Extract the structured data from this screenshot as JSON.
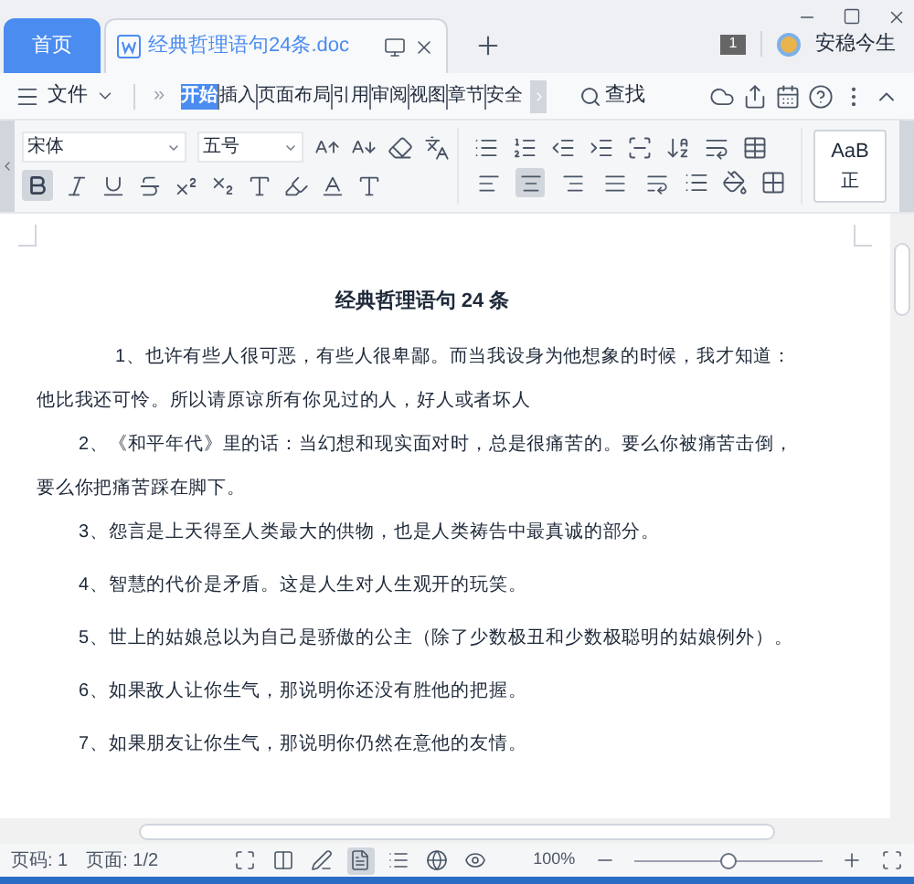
{
  "window": {
    "tabs": [
      {
        "label": "首页",
        "kind": "home",
        "selected": false
      },
      {
        "label": "经典哲理语句24条.doc",
        "kind": "doc",
        "selected": true
      }
    ],
    "badge": "1",
    "user": "安稳今生"
  },
  "menu": {
    "file": "文件",
    "more": "»",
    "search": "查找",
    "tabs": [
      {
        "label": "开始",
        "selected": true
      },
      {
        "label": "插入",
        "selected": false
      },
      {
        "label": "页面布局",
        "selected": false
      },
      {
        "label": "引用",
        "selected": false
      },
      {
        "label": "审阅",
        "selected": false
      },
      {
        "label": "视图",
        "selected": false
      },
      {
        "label": "章节",
        "selected": false
      },
      {
        "label": "安全",
        "selected": false
      }
    ]
  },
  "ribbon": {
    "font": "宋体",
    "size": "五号",
    "bold_selected": true,
    "align": [
      {
        "kind": "left",
        "selected": false
      },
      {
        "kind": "center",
        "selected": true
      },
      {
        "kind": "right",
        "selected": false
      },
      {
        "kind": "justify",
        "selected": false
      },
      {
        "kind": "distribute",
        "selected": false
      }
    ],
    "style_preview": [
      "AaB",
      "正"
    ]
  },
  "document": {
    "title": "经典哲理语句 24 条",
    "paragraphs": [
      "1、也许有些人很可恶，有些人很卑鄙。而当我设身为他想象的时候，我才知道：他比我还可怜。所以请原谅所有你见过的人，好人或者坏人",
      "2、《和平年代》里的话：当幻想和现实面对时，总是很痛苦的。要么你被痛苦击倒，要么你把痛苦踩在脚下。",
      "3、怨言是上天得至人类最大的供物，也是人类祷告中最真诚的部分。",
      "4、智慧的代价是矛盾。这是人生对人生观开的玩笑。",
      "5、世上的姑娘总以为自己是骄傲的公主（除了少数极丑和少数极聪明的姑娘例外）。",
      "6、如果敌人让你生气，那说明你还没有胜他的把握。",
      "7、如果朋友让你生气，那说明你仍然在意他的友情。"
    ]
  },
  "status": {
    "page": "页码: 1",
    "pages": "页面: 1/2",
    "zoom": "100%",
    "views": [
      {
        "kind": "fullscreen",
        "selected": false
      },
      {
        "kind": "read",
        "selected": false
      },
      {
        "kind": "write",
        "selected": false
      },
      {
        "kind": "page",
        "selected": true
      },
      {
        "kind": "outline",
        "selected": false
      },
      {
        "kind": "web",
        "selected": false
      },
      {
        "kind": "eye",
        "selected": false
      }
    ],
    "zoom_slider": {
      "level": 0.5
    }
  }
}
